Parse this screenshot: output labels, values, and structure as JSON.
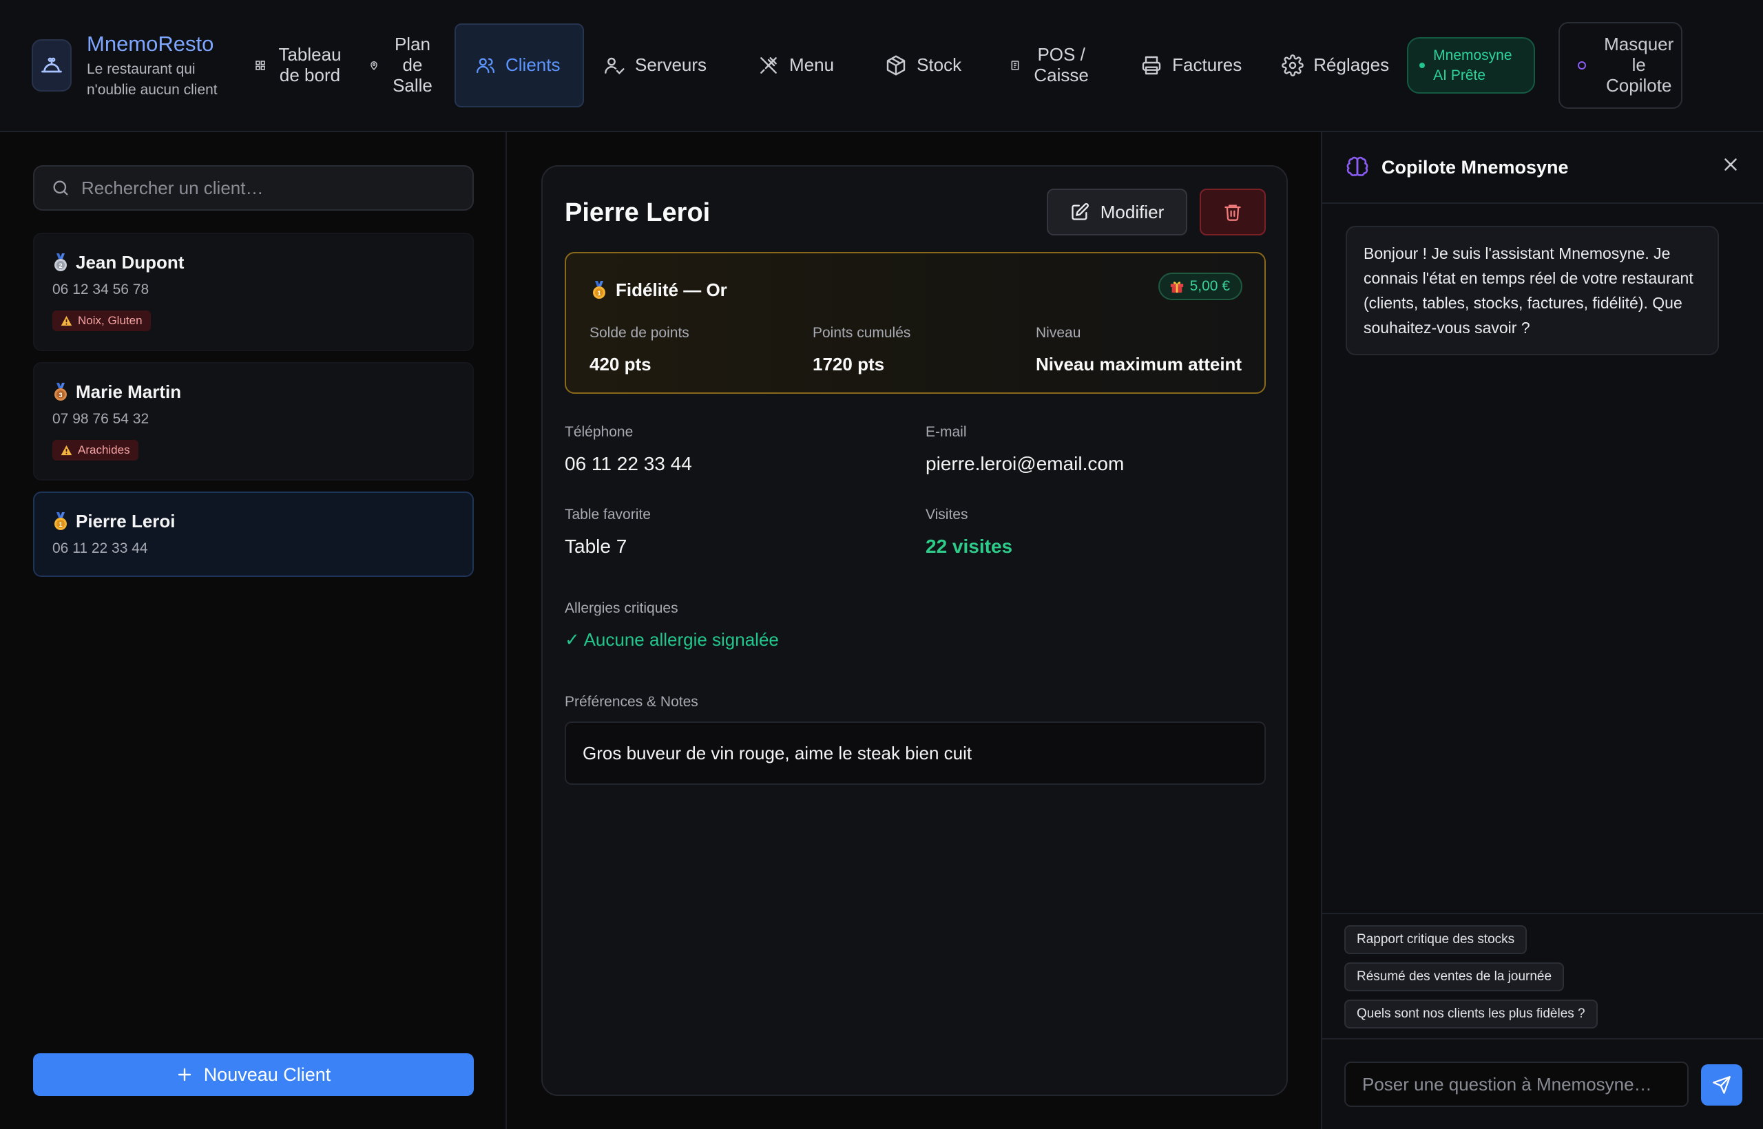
{
  "app": {
    "name": "MnemoResto",
    "tagline": "Le restaurant qui n'oublie aucun client"
  },
  "nav": {
    "items": [
      {
        "label": "Tableau de bord",
        "icon": "grid-icon"
      },
      {
        "label": "Plan de Salle",
        "icon": "map-pin-icon"
      },
      {
        "label": "Clients",
        "icon": "users-icon",
        "active": true
      },
      {
        "label": "Serveurs",
        "icon": "user-check-icon"
      },
      {
        "label": "Menu",
        "icon": "utensils-crossed-icon"
      },
      {
        "label": "Stock",
        "icon": "package-icon"
      },
      {
        "label": "POS / Caisse",
        "icon": "receipt-icon"
      },
      {
        "label": "Factures",
        "icon": "printer-icon"
      },
      {
        "label": "Réglages",
        "icon": "gear-icon"
      }
    ],
    "ai_status": "Mnemosyne AI Prête",
    "hide_copilot": "Masquer le Copilote"
  },
  "sidebar": {
    "search_placeholder": "Rechercher un client…",
    "clients": [
      {
        "name": "Jean Dupont",
        "phone": "06 12 34 56 78",
        "allergies": "Noix, Gluten",
        "medal": "silver"
      },
      {
        "name": "Marie Martin",
        "phone": "07 98 76 54 32",
        "allergies": "Arachides",
        "medal": "bronze"
      },
      {
        "name": "Pierre Leroi",
        "phone": "06 11 22 33 44",
        "allergies": "",
        "medal": "gold",
        "selected": true
      }
    ],
    "new_client_label": "Nouveau Client"
  },
  "detail": {
    "name": "Pierre Leroi",
    "edit_label": "Modifier",
    "loyalty": {
      "title": "Fidélité — Or",
      "reward": "5,00 €",
      "balance_label": "Solde de points",
      "balance_value": "420 pts",
      "cumulated_label": "Points cumulés",
      "cumulated_value": "1720 pts",
      "level_label": "Niveau",
      "level_value": "Niveau maximum atteint"
    },
    "phone_label": "Téléphone",
    "phone": "06 11 22 33 44",
    "email_label": "E-mail",
    "email": "pierre.leroi@email.com",
    "table_label": "Table favorite",
    "table": "Table 7",
    "visits_label": "Visites",
    "visits": "22 visites",
    "allergies_label": "Allergies critiques",
    "allergies": "✓ Aucune allergie signalée",
    "notes_label": "Préférences & Notes",
    "notes": "Gros buveur de vin rouge, aime le steak bien cuit"
  },
  "copilot": {
    "title": "Copilote Mnemosyne",
    "greeting": "Bonjour ! Je suis l'assistant Mnemosyne. Je connais l'état en temps réel de votre restaurant (clients, tables, stocks, factures, fidélité). Que souhaitez-vous savoir ?",
    "suggestions": [
      "Rapport critique des stocks",
      "Résumé des ventes de la journée",
      "Quels sont nos clients les plus fidèles ?"
    ],
    "input_placeholder": "Poser une question à Mnemosyne…"
  },
  "colors": {
    "accent": "#3b82f6",
    "success": "#22c58b",
    "gold_border": "#8a6a1a",
    "danger": "#f07a7a"
  }
}
